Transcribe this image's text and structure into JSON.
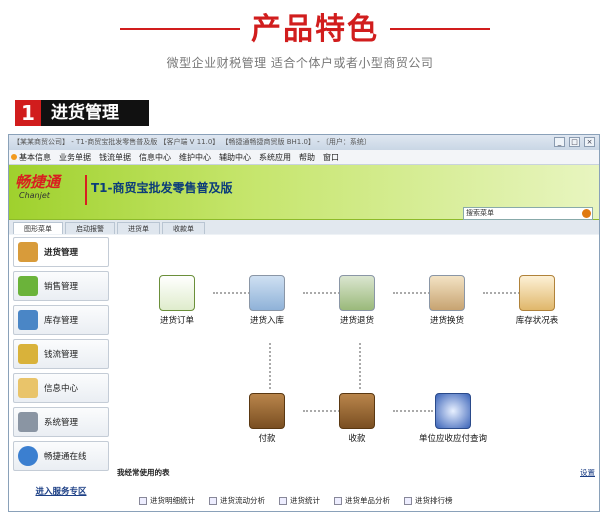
{
  "header": {
    "title": "产品特色",
    "subtitle": "微型企业财税管理 适合个体户或者小型商贸公司"
  },
  "section": {
    "number": "1",
    "label": "进货管理"
  },
  "app": {
    "window_title": "【某某商贸公司】 - T1-商贸宝批发零售普及版 【客户端 V 11.0】 【畅捷通畅捷商贸版 BH1.0】 - 〔用户：系统〕",
    "window_controls": [
      "_",
      "□",
      "×"
    ],
    "menu": [
      "基本信息",
      "业务单据",
      "钱流单据",
      "信息中心",
      "维护中心",
      "辅助中心",
      "系统应用",
      "帮助",
      "窗口"
    ],
    "brand": {
      "name_cn": "畅捷通",
      "name_en": "Chanjet",
      "product": "T1-商贸宝批发零售普及版"
    },
    "search": {
      "label": "搜索菜单"
    },
    "tabs": [
      "图形菜单",
      "启动报警",
      "进货单",
      "收款单"
    ],
    "sidebar": [
      {
        "label": "进货管理",
        "icon": "truck-icon"
      },
      {
        "label": "销售管理",
        "icon": "cart-icon"
      },
      {
        "label": "库存管理",
        "icon": "warehouse-icon"
      },
      {
        "label": "钱流管理",
        "icon": "money-icon"
      },
      {
        "label": "信息中心",
        "icon": "mail-icon"
      },
      {
        "label": "系统管理",
        "icon": "gear-icon"
      },
      {
        "label": "畅捷通在线",
        "icon": "globe-icon"
      }
    ],
    "service_link": "进入服务专区",
    "flow": {
      "purchase_order": "进货订单",
      "purchase_in": "进货入库",
      "purchase_return": "进货退货",
      "purchase_exchange": "进货换货",
      "stock_status": "库存状况表",
      "payment": "付款",
      "receipt": "收款",
      "ar_ap_query": "单位应收应付查询"
    },
    "reports_title": "我经常使用的表",
    "reports_settings": "设置",
    "reports": [
      "进货明细统计",
      "进货流动分析",
      "进货统计",
      "进货单品分析",
      "进货排行榜"
    ],
    "colors": {
      "accent": "#d11d1d",
      "banner_green": "#9fd12d",
      "nav_blue": "#1c3f85"
    }
  }
}
